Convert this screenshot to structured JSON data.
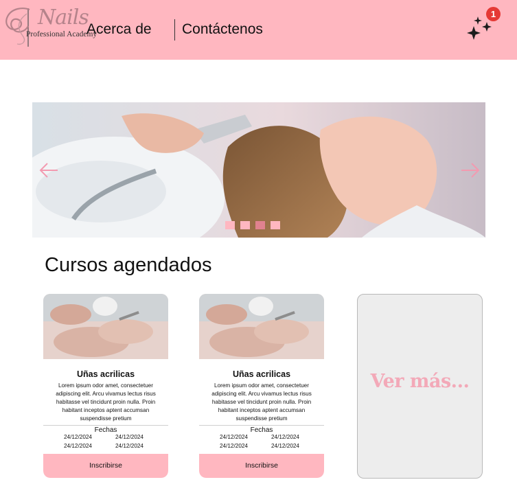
{
  "header": {
    "logo": {
      "script": "Nails",
      "subtitle": "Professional Academy"
    },
    "nav": {
      "about": "Acerca de",
      "contact": "Contáctenos"
    },
    "notification_count": "1",
    "icon": "sparkle-icon",
    "background": "#ffb7c0"
  },
  "hero": {
    "left_arrow_icon": "arrow-left-icon",
    "right_arrow_icon": "arrow-right-icon",
    "slides": 4,
    "active_slide": 3
  },
  "section": {
    "title": "Cursos agendados"
  },
  "courses": [
    {
      "title": "Uñas acrilicas",
      "description": "Lorem ipsum odor amet, consectetuer adipiscing elit. Arcu vivamus lectus risus habitasse vel tincidunt proin nulla. Proin habitant inceptos aptent accumsan suspendisse pretium",
      "dates_label": "Fechas",
      "dates": [
        "24/12/2024",
        "24/12/2024",
        "24/12/2024",
        "24/12/2024"
      ],
      "button": "Inscribirse"
    },
    {
      "title": "Uñas acrilicas",
      "description": "Lorem ipsum odor amet, consectetuer adipiscing elit. Arcu vivamus lectus risus habitasse vel tincidunt proin nulla. Proin habitant inceptos aptent accumsan suspendisse pretium",
      "dates_label": "Fechas",
      "dates": [
        "24/12/2024",
        "24/12/2024",
        "24/12/2024",
        "24/12/2024"
      ],
      "button": "Inscribirse"
    }
  ],
  "more": {
    "label": "Ver más..."
  },
  "colors": {
    "accent": "#ffb7c0",
    "accent_dark": "#e0828f",
    "more_text": "#f3a9b8"
  }
}
